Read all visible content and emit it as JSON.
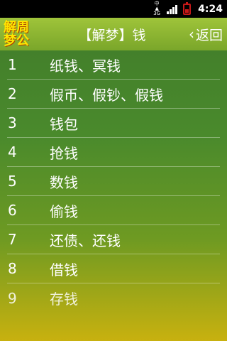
{
  "status_bar": {
    "network_label_top": "中▲",
    "network_label_bottom": "3G",
    "time": "4:24"
  },
  "header": {
    "logo_line1": "解周",
    "logo_line2": "梦公",
    "title": "【解梦】钱",
    "back_icon": "chevron-left",
    "back_label": "返回"
  },
  "list": {
    "items": [
      {
        "num": "1",
        "label": "纸钱、冥钱"
      },
      {
        "num": "2",
        "label": "假币、假钞、假钱"
      },
      {
        "num": "3",
        "label": "钱包"
      },
      {
        "num": "4",
        "label": "抢钱"
      },
      {
        "num": "5",
        "label": "数钱"
      },
      {
        "num": "6",
        "label": "偷钱"
      },
      {
        "num": "7",
        "label": "还债、还钱"
      },
      {
        "num": "8",
        "label": "借钱"
      },
      {
        "num": "9",
        "label": "存钱"
      }
    ]
  }
}
